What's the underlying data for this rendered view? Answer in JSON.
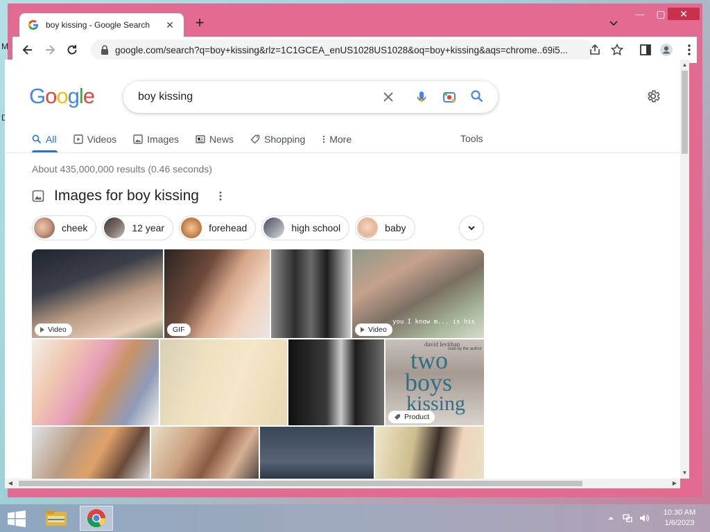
{
  "desktop": {
    "letters": [
      "M",
      "D"
    ]
  },
  "browser": {
    "tab_title": "boy kissing - Google Search",
    "url": "google.com/search?q=boy+kissing&rlz=1C1GCEA_enUS1028US1028&oq=boy+kissing&aqs=chrome..69i5..."
  },
  "google": {
    "query": "boy kissing",
    "nav": [
      "All",
      "Videos",
      "Images",
      "News",
      "Shopping",
      "More"
    ],
    "tools": "Tools",
    "stats": "About 435,000,000 results (0.46 seconds)",
    "images_heading": "Images for boy kissing",
    "chips": [
      "cheek",
      "12 year",
      "forehead",
      "high school",
      "baby"
    ],
    "badges": {
      "video": "Video",
      "gif": "GIF",
      "product": "Product"
    },
    "book_text": {
      "author": "david levithan",
      "subtitle": "read by the author",
      "title_line1": "two",
      "title_line2": "boys",
      "title_line3": "kissing"
    },
    "subtitle_text": "you I know m... is his"
  },
  "taskbar": {
    "time": "10:30 AM",
    "date": "1/6/2023"
  },
  "colors": {
    "window_frame": "#e36a91",
    "google_blue": "#1a73e8",
    "close_red": "#c9304d"
  }
}
